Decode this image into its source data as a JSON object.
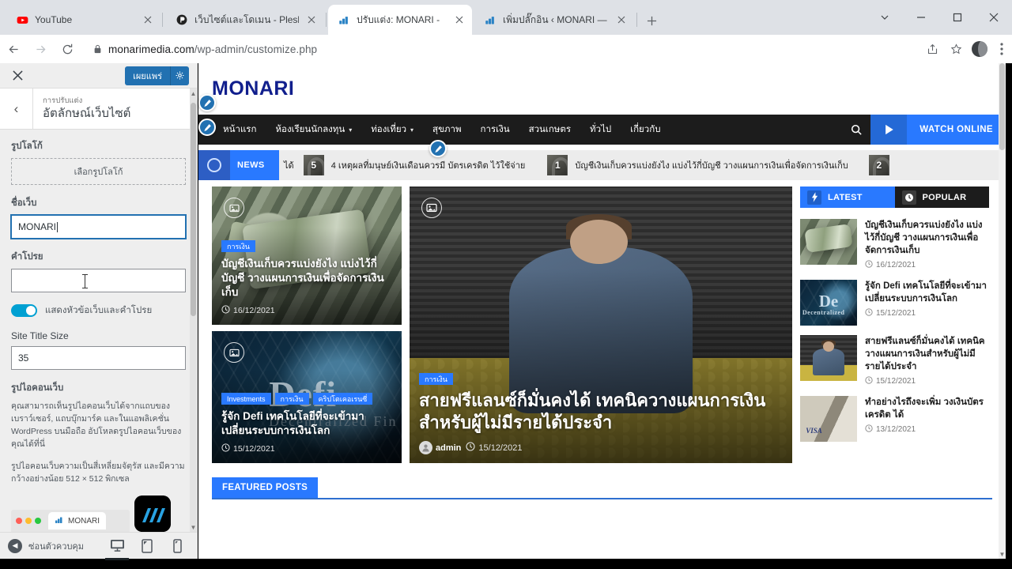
{
  "browser": {
    "tabs": [
      {
        "title": "YouTube",
        "favicon": "youtube-icon",
        "active": false
      },
      {
        "title": "เว็บไซต์และโดเมน - Plesk Obsidian",
        "favicon": "plesk-icon",
        "active": false
      },
      {
        "title": "ปรับแต่ง: MONARI -",
        "favicon": "wordpress-icon",
        "active": true
      },
      {
        "title": "เพิ่มปลั๊กอิน ‹ MONARI — WordPre",
        "favicon": "wordpress-icon",
        "active": false
      }
    ],
    "new_tab_label": "+",
    "url_prefix": "monarimedia.com",
    "url_suffix": "/wp-admin/customize.php",
    "url_full": "monarimedia.com/wp-admin/customize.php",
    "window_controls": {
      "minimize": "−",
      "maximize": "▢",
      "close": "✕",
      "tab_search": "⌄"
    },
    "toolbar_icons": [
      "back-icon",
      "forward-icon",
      "reload-icon",
      "lock-icon",
      "share-icon",
      "bookmark-star-icon",
      "profile-avatar",
      "chrome-menu-icon"
    ]
  },
  "customizer": {
    "close_label": "✕",
    "publish_label": "เผยแพร่",
    "gear_label": "⚙",
    "back_label": "‹",
    "eyebrow": "การปรับแต่ง",
    "title": "อัตลักษณ์เว็บไซต์",
    "logo_label": "รูปโลโก้",
    "logo_button": "เลือกรูปโลโก้",
    "site_title_label": "ชื่อเว็บ",
    "site_title_value": "MONARI",
    "tagline_label": "คำโปรย",
    "tagline_value": "",
    "toggle_label": "แสดงหัวข้อเว็บและคำโปรย",
    "toggle_on": true,
    "site_title_size_label": "Site Title Size",
    "site_title_size_value": "35",
    "site_icon_label": "รูปไอคอนเว็บ",
    "site_icon_desc1": "คุณสามารถเห็นรูปไอคอนเว็บได้จากแถบของเบราว์เซอร์, แถบบุ๊กมาร์ค และในแอพลิเคชั่น WordPress บนมือถือ อัปโหลดรูปไอคอนเว็บของคุณได้ที่นี่",
    "site_icon_desc2": "รูปไอคอนเว็บความเป็นสี่เหลี่ยมจัตุรัส และมีความกว้างอย่างน้อย 512 × 512 พิกเซล",
    "preview_tab_title": "MONARI",
    "collapse_label": "ซ่อนตัวควบคุม",
    "devices": [
      {
        "name": "desktop-preview",
        "icon": "desktop-icon",
        "active": true
      },
      {
        "name": "tablet-preview",
        "icon": "tablet-icon",
        "active": false
      },
      {
        "name": "mobile-preview",
        "icon": "mobile-icon",
        "active": false
      }
    ]
  },
  "site": {
    "logo_text": "MONARI",
    "nav": [
      {
        "label": "หน้าแรก",
        "has_dropdown": false
      },
      {
        "label": "ห้องเรียนนักลงทุน",
        "has_dropdown": true
      },
      {
        "label": "ท่องเที่ยว",
        "has_dropdown": true
      },
      {
        "label": "สุขภาพ",
        "has_dropdown": false
      },
      {
        "label": "การเงิน",
        "has_dropdown": false
      },
      {
        "label": "สวนเกษตร",
        "has_dropdown": false
      },
      {
        "label": "ทั่วไป",
        "has_dropdown": false
      },
      {
        "label": "เกี่ยวกับ",
        "has_dropdown": false
      }
    ],
    "nav_search_icon": "search-icon",
    "watch_online_label": "WATCH ONLINE",
    "ticker": {
      "badge_label": "NEWS",
      "leading_fragment": "ได้",
      "items": [
        {
          "number": "5",
          "title": "4 เหตุผลที่มนุษย์เงินเดือนควรมี บัตรเครดิต ไว้ใช้จ่าย"
        },
        {
          "number": "1",
          "title": "บัญชีเงินเก็บควรแบ่งยังไง แบ่งไว้กี่บัญชี วางแผนการเงินเพื่อจัดการเงินเก็บ"
        },
        {
          "number": "2",
          "title": ""
        }
      ]
    },
    "cards": {
      "left_top": {
        "categories": [
          "การเงิน"
        ],
        "title": "บัญชีเงินเก็บควรแบ่งยังไง แบ่งไว้กี่บัญชี วางแผนการเงินเพื่อจัดการเงินเก็บ",
        "date": "16/12/2021",
        "gallery_icon": "gallery-icon"
      },
      "left_bottom": {
        "categories": [
          "Investments",
          "การเงิน",
          "คริปโตเคอเรนซี่"
        ],
        "title": "รู้จัก Defi เทคโนโลยีที่จะเข้ามาเปลี่ยนระบบการเงินโลก",
        "date": "15/12/2021",
        "gallery_icon": "gallery-icon"
      },
      "hero": {
        "categories": [
          "การเงิน"
        ],
        "title": "สายฟรีแลนซ์ก็มั่นคงได้ เทคนิควางแผนการเงินสำหรับผู้ไม่มีรายได้ประจำ",
        "author": "admin",
        "date": "15/12/2021",
        "gallery_icon": "gallery-icon"
      }
    },
    "sidebar": {
      "tabs": [
        {
          "label": "LATEST",
          "icon": "flash-icon",
          "active": true
        },
        {
          "label": "POPULAR",
          "icon": "clock-icon",
          "active": false
        }
      ],
      "items": [
        {
          "title": "บัญชีเงินเก็บควรแบ่งยังไง แบ่งไว้กี่บัญชี วางแผนการเงินเพื่อจัดการเงินเก็บ",
          "date": "16/12/2021",
          "thumb": "money"
        },
        {
          "title": "รู้จัก Defi เทคโนโลยีที่จะเข้ามาเปลี่ยนระบบการเงินโลก",
          "date": "15/12/2021",
          "thumb": "defi"
        },
        {
          "title": "สายฟรีแลนซ์ก็มั่นคงได้ เทคนิควางแผนการเงินสำหรับผู้ไม่มีรายได้ประจำ",
          "date": "15/12/2021",
          "thumb": "person"
        },
        {
          "title": "ทำอย่างไรถึงจะเพิ่ม วงเงินบัตรเครดิต ได้",
          "date": "13/12/2021",
          "thumb": "visa"
        }
      ]
    },
    "featured_label": "FEATURED POSTS"
  },
  "colors": {
    "accent_blue": "#2979ff",
    "wp_blue": "#2271b1",
    "nav_dark": "#1c1c1c",
    "logo_navy": "#111f8d",
    "toggle_on": "#00a0d2",
    "chrome_bg": "#dee1e6"
  }
}
